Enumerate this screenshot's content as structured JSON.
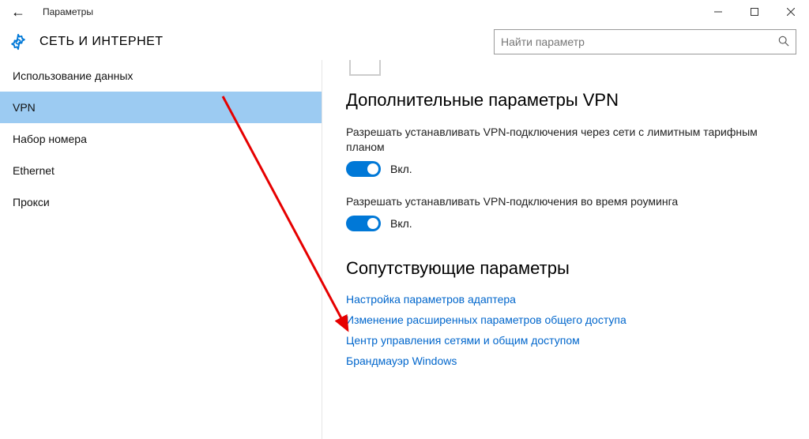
{
  "window": {
    "title": "Параметры"
  },
  "header": {
    "title": "СЕТЬ И ИНТЕРНЕТ",
    "search_placeholder": "Найти параметр"
  },
  "sidebar": {
    "items": [
      {
        "label": "Использование данных",
        "selected": false
      },
      {
        "label": "VPN",
        "selected": true
      },
      {
        "label": "Набор номера",
        "selected": false
      },
      {
        "label": "Ethernet",
        "selected": false
      },
      {
        "label": "Прокси",
        "selected": false
      }
    ]
  },
  "content": {
    "advanced_title": "Дополнительные параметры VPN",
    "setting1": {
      "desc": "Разрешать устанавливать VPN-подключения через сети с лимитным тарифным планом",
      "state_label": "Вкл.",
      "on": true
    },
    "setting2": {
      "desc": "Разрешать устанавливать VPN-подключения во время роуминга",
      "state_label": "Вкл.",
      "on": true
    },
    "related_title": "Сопутствующие параметры",
    "links": [
      "Настройка параметров адаптера",
      "Изменение расширенных параметров общего доступа",
      "Центр управления сетями и общим доступом",
      "Брандмауэр Windows"
    ]
  },
  "annotation": {
    "arrow_color": "#e60000"
  }
}
